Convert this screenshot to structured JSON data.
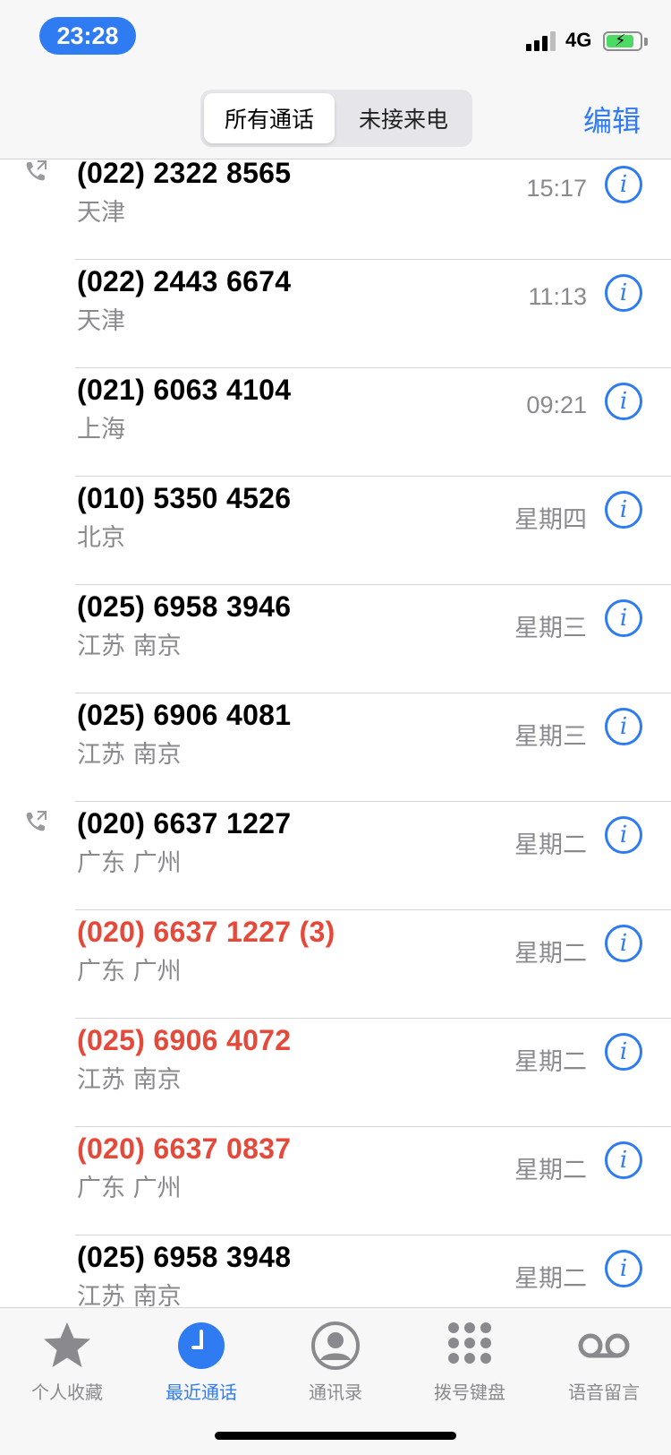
{
  "status_bar": {
    "time": "23:28",
    "network": "4G",
    "icons": [
      "signal-icon",
      "battery-charging-icon"
    ]
  },
  "nav": {
    "segments": [
      "所有通话",
      "未接来电"
    ],
    "selected_segment": "所有通话",
    "edit_label": "编辑"
  },
  "calls": [
    {
      "number": "(022) 2322 8565",
      "location": "天津",
      "time": "15:17",
      "missed": false,
      "outgoing": true
    },
    {
      "number": "(022) 2443 6674",
      "location": "天津",
      "time": "11:13",
      "missed": false,
      "outgoing": false
    },
    {
      "number": "(021) 6063 4104",
      "location": "上海",
      "time": "09:21",
      "missed": false,
      "outgoing": false
    },
    {
      "number": "(010) 5350 4526",
      "location": "北京",
      "time": "星期四",
      "missed": false,
      "outgoing": false
    },
    {
      "number": "(025) 6958 3946",
      "location": "江苏 南京",
      "time": "星期三",
      "missed": false,
      "outgoing": false
    },
    {
      "number": "(025) 6906 4081",
      "location": "江苏 南京",
      "time": "星期三",
      "missed": false,
      "outgoing": false
    },
    {
      "number": "(020) 6637 1227",
      "location": "广东 广州",
      "time": "星期二",
      "missed": false,
      "outgoing": true
    },
    {
      "number": "(020) 6637 1227 (3)",
      "location": "广东 广州",
      "time": "星期二",
      "missed": true,
      "outgoing": false
    },
    {
      "number": "(025) 6906 4072",
      "location": "江苏 南京",
      "time": "星期二",
      "missed": true,
      "outgoing": false
    },
    {
      "number": "(020) 6637 0837",
      "location": "广东 广州",
      "time": "星期二",
      "missed": true,
      "outgoing": false
    },
    {
      "number": "(025) 6958 3948",
      "location": "江苏 南京",
      "time": "星期二",
      "missed": false,
      "outgoing": false
    }
  ],
  "tab_bar": {
    "tabs": [
      {
        "label": "个人收藏",
        "icon": "star-icon"
      },
      {
        "label": "最近通话",
        "icon": "clock-icon"
      },
      {
        "label": "通讯录",
        "icon": "contact-icon"
      },
      {
        "label": "拨号键盘",
        "icon": "keypad-icon"
      },
      {
        "label": "语音留言",
        "icon": "voicemail-icon"
      }
    ],
    "active": "最近通话"
  },
  "colors": {
    "accent": "#2f7bf2",
    "missed": "#e5493a",
    "secondary_text": "#8a8a8e"
  }
}
